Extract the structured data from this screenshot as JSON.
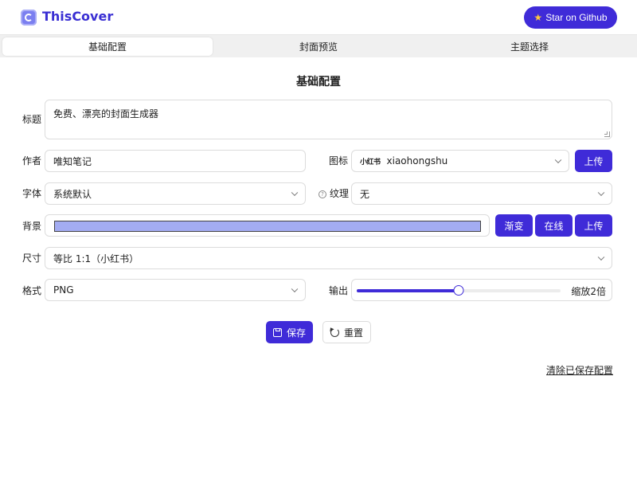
{
  "header": {
    "app_name": "ThisCover",
    "star_label": "Star on Github",
    "star_icon": "★"
  },
  "tabs": [
    {
      "label": "基础配置",
      "active": true
    },
    {
      "label": "封面预览",
      "active": false
    },
    {
      "label": "主题选择",
      "active": false
    }
  ],
  "section_title": "基础配置",
  "form": {
    "title_label": "标题",
    "title_value": "免费、漂亮的封面生成器",
    "author_label": "作者",
    "author_value": "唯知笔记",
    "icon_label": "图标",
    "icon_mark": "小红书",
    "icon_value": "xiaohongshu",
    "upload_label": "上传",
    "font_label": "字体",
    "font_value": "系统默认",
    "texture_help": "?",
    "texture_label": "纹理",
    "texture_value": "无",
    "background_label": "背景",
    "background_color": "#a3acf2",
    "gradient_label": "渐变",
    "online_label": "在线",
    "bg_upload_label": "上传",
    "size_label": "尺寸",
    "size_value": "等比 1:1（小红书）",
    "format_label": "格式",
    "format_value": "PNG",
    "output_label": "输出",
    "output_scale_value": 2,
    "output_scale_max": 4,
    "output_scale_text": "缩放2倍"
  },
  "actions": {
    "save_label": "保存",
    "reset_label": "重置"
  },
  "clear_link": "清除已保存配置",
  "colors": {
    "accent": "#3f2bd8",
    "brand_text": "#3a2fd3"
  }
}
